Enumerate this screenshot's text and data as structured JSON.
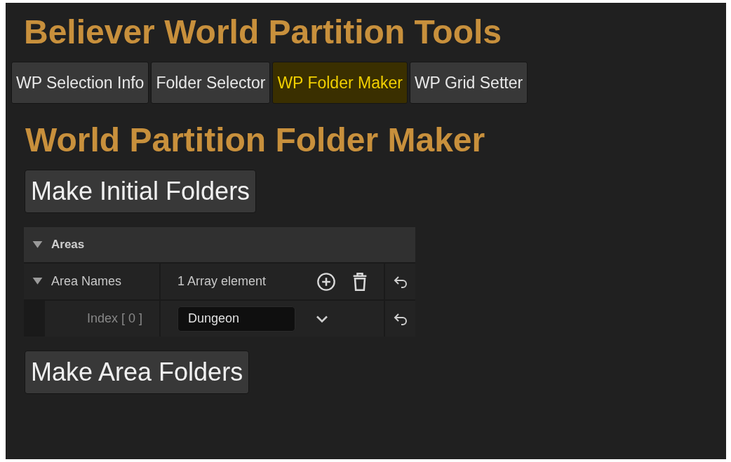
{
  "title": "Believer World Partition Tools",
  "tabs": [
    {
      "label": "WP Selection Info",
      "selected": false
    },
    {
      "label": "Folder Selector",
      "selected": false
    },
    {
      "label": "WP Folder Maker",
      "selected": true
    },
    {
      "label": "WP Grid Setter",
      "selected": false
    }
  ],
  "heading": "World Partition Folder Maker",
  "initial_button": "Make Initial Folders",
  "details": {
    "category": "Areas",
    "expanded": true,
    "array": {
      "label": "Area Names",
      "expanded": true,
      "count": "1 Array element",
      "elements": [
        {
          "index_label": "Index [ 0 ]",
          "value": "Dungeon"
        }
      ]
    }
  },
  "area_button": "Make Area Folders"
}
